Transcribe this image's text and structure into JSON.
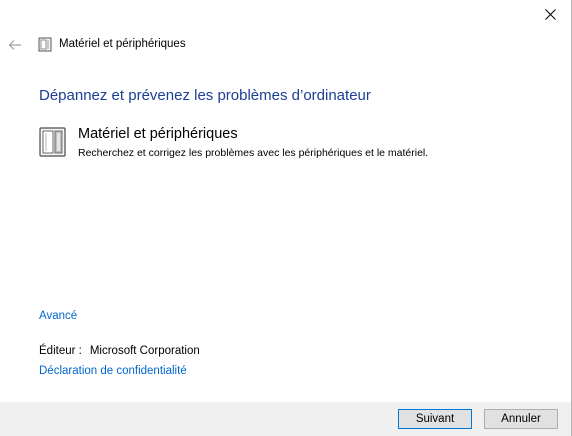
{
  "window": {
    "title": "Matériel et périphériques",
    "icons": {
      "back": "back-arrow-icon",
      "close": "close-icon",
      "title": "hardware-device-icon"
    }
  },
  "main": {
    "heading": "Dépannez et prévenez les problèmes d’ordinateur",
    "item": {
      "title": "Matériel et périphériques",
      "description": "Recherchez et corrigez les problèmes avec les périphériques et le matériel.",
      "icon": "hardware-device-icon"
    },
    "advanced_link": "Avancé",
    "publisher_label": "Éditeur :",
    "publisher_value": "Microsoft Corporation",
    "privacy_link": "Déclaration de confidentialité"
  },
  "footer": {
    "next_label": "Suivant",
    "cancel_label": "Annuler"
  },
  "colors": {
    "heading": "#1c3f94",
    "link": "#0066cc",
    "footer_bg": "#f0f0f0",
    "button_bg": "#e1e1e1"
  }
}
